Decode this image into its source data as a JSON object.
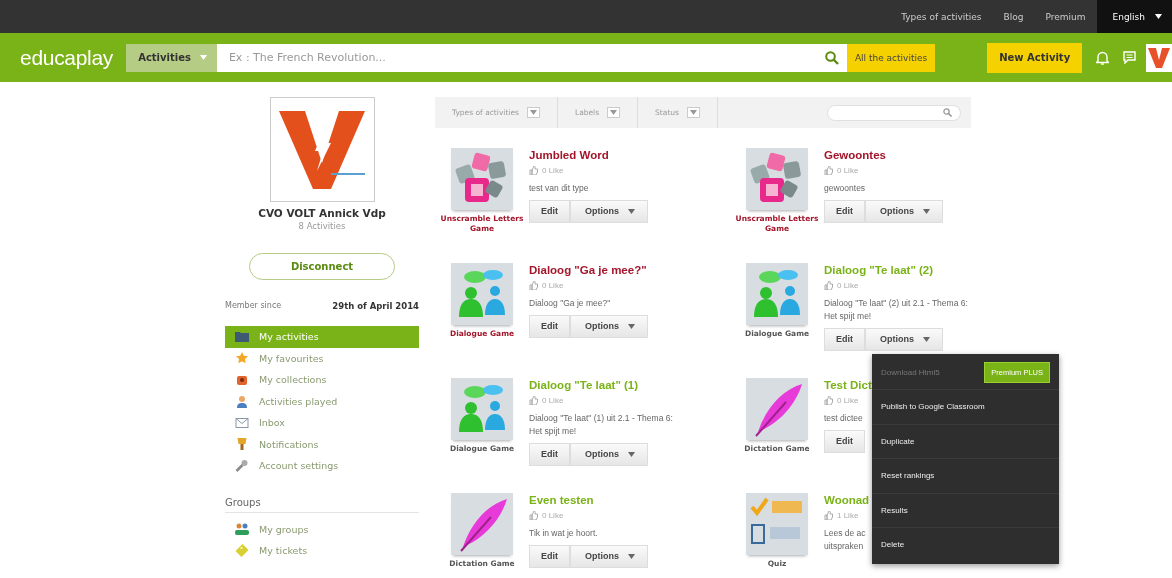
{
  "top_links": [
    {
      "label": "Types of activities",
      "selected": false
    },
    {
      "label": "Blog",
      "selected": false
    },
    {
      "label": "Premium",
      "selected": false
    },
    {
      "label": "English",
      "selected": true
    }
  ],
  "header": {
    "logo": "educaplay",
    "category": "Activities",
    "search_placeholder": "Ex : The French Revolution...",
    "all_button": "All the activities",
    "new_button": "New Activity"
  },
  "profile": {
    "name": "CVO VOLT Annick Vdp",
    "count": "8 Activities",
    "disconnect": "Disconnect",
    "member_label": "Member since",
    "member_date": "29th of April 2014"
  },
  "sidebar": {
    "items": [
      {
        "label": "My activities",
        "kind": "folder",
        "selected": true
      },
      {
        "label": "My favourites",
        "kind": "star",
        "selected": false
      },
      {
        "label": "My collections",
        "kind": "box",
        "selected": false
      },
      {
        "label": "Activities played",
        "kind": "person",
        "selected": false
      },
      {
        "label": "Inbox",
        "kind": "mail",
        "selected": false
      },
      {
        "label": "Notifications",
        "kind": "trophy",
        "selected": false
      },
      {
        "label": "Account settings",
        "kind": "wrench",
        "selected": false
      }
    ],
    "groups_title": "Groups",
    "group_items": [
      {
        "label": "My groups",
        "kind": "group",
        "selected": false
      },
      {
        "label": "My tickets",
        "kind": "ticket",
        "selected": false
      }
    ]
  },
  "filters": [
    {
      "label": "Types of activities"
    },
    {
      "label": "Labels"
    },
    {
      "label": "Status"
    }
  ],
  "activities": [
    {
      "title": "Jumbled Word",
      "likes": "0 Like",
      "description": "test van dit type",
      "type_label": "Unscramble Letters Game",
      "kind": "letters",
      "color": "#a3152a",
      "buttons": [
        "Edit",
        "Options"
      ]
    },
    {
      "title": "Gewoontes",
      "likes": "0 Like",
      "description": "gewoontes",
      "type_label": "Unscramble Letters Game",
      "kind": "letters",
      "color": "#a3152a",
      "buttons": [
        "Edit",
        "Options"
      ]
    },
    {
      "title": "Dialoog \"Ga je mee?\"",
      "likes": "0 Like",
      "description": "Dialoog \"Ga je mee?\"",
      "type_label": "Dialogue Game",
      "kind": "dialogue",
      "color": "#a3152a",
      "buttons": [
        "Edit",
        "Options"
      ]
    },
    {
      "title": "Dialoog \"Te laat\" (2)",
      "likes": "0 Like",
      "description": "Dialoog \"Te laat\" (2) uit 2.1 - Thema 6: Het spijt me!",
      "type_label": "Dialogue Game",
      "kind": "dialogue",
      "color": "#7ab317",
      "buttons": [
        "Edit",
        "Options"
      ],
      "options_menu": [
        {
          "label": "Download Html5",
          "disabled": true,
          "badge": "Premium PLUS"
        },
        {
          "label": "Publish to Google Classroom",
          "disabled": false
        },
        {
          "label": "Duplicate",
          "disabled": false
        },
        {
          "label": "Reset rankings",
          "disabled": false
        },
        {
          "label": "Results",
          "disabled": false
        },
        {
          "label": "Delete",
          "disabled": false
        }
      ]
    },
    {
      "title": "Dialoog \"Te laat\" (1)",
      "likes": "0 Like",
      "description": "Dialoog \"Te laat\" (1) uit 2.1 - Thema 6: Het spijt me!",
      "type_label": "Dialogue Game",
      "kind": "dialogue",
      "color": "#7ab317",
      "buttons": [
        "Edit",
        "Options"
      ]
    },
    {
      "title": "Test Dict",
      "likes": "0 Like",
      "description": "test dictee",
      "type_label": "Dictation Game",
      "kind": "feather",
      "color": "#7ab317",
      "buttons": [
        "Edit"
      ]
    },
    {
      "title": "Even testen",
      "likes": "0 Like",
      "description": "Tik in wat je hoort.",
      "type_label": "Dictation Game",
      "kind": "feather",
      "color": "#7ab317",
      "buttons": [
        "Edit",
        "Options"
      ]
    },
    {
      "title": "Woonad",
      "likes": "1 Like",
      "description": "Lees de ac uitspraken",
      "type_label": "Quiz",
      "kind": "quiz",
      "color": "#7ab317"
    }
  ]
}
